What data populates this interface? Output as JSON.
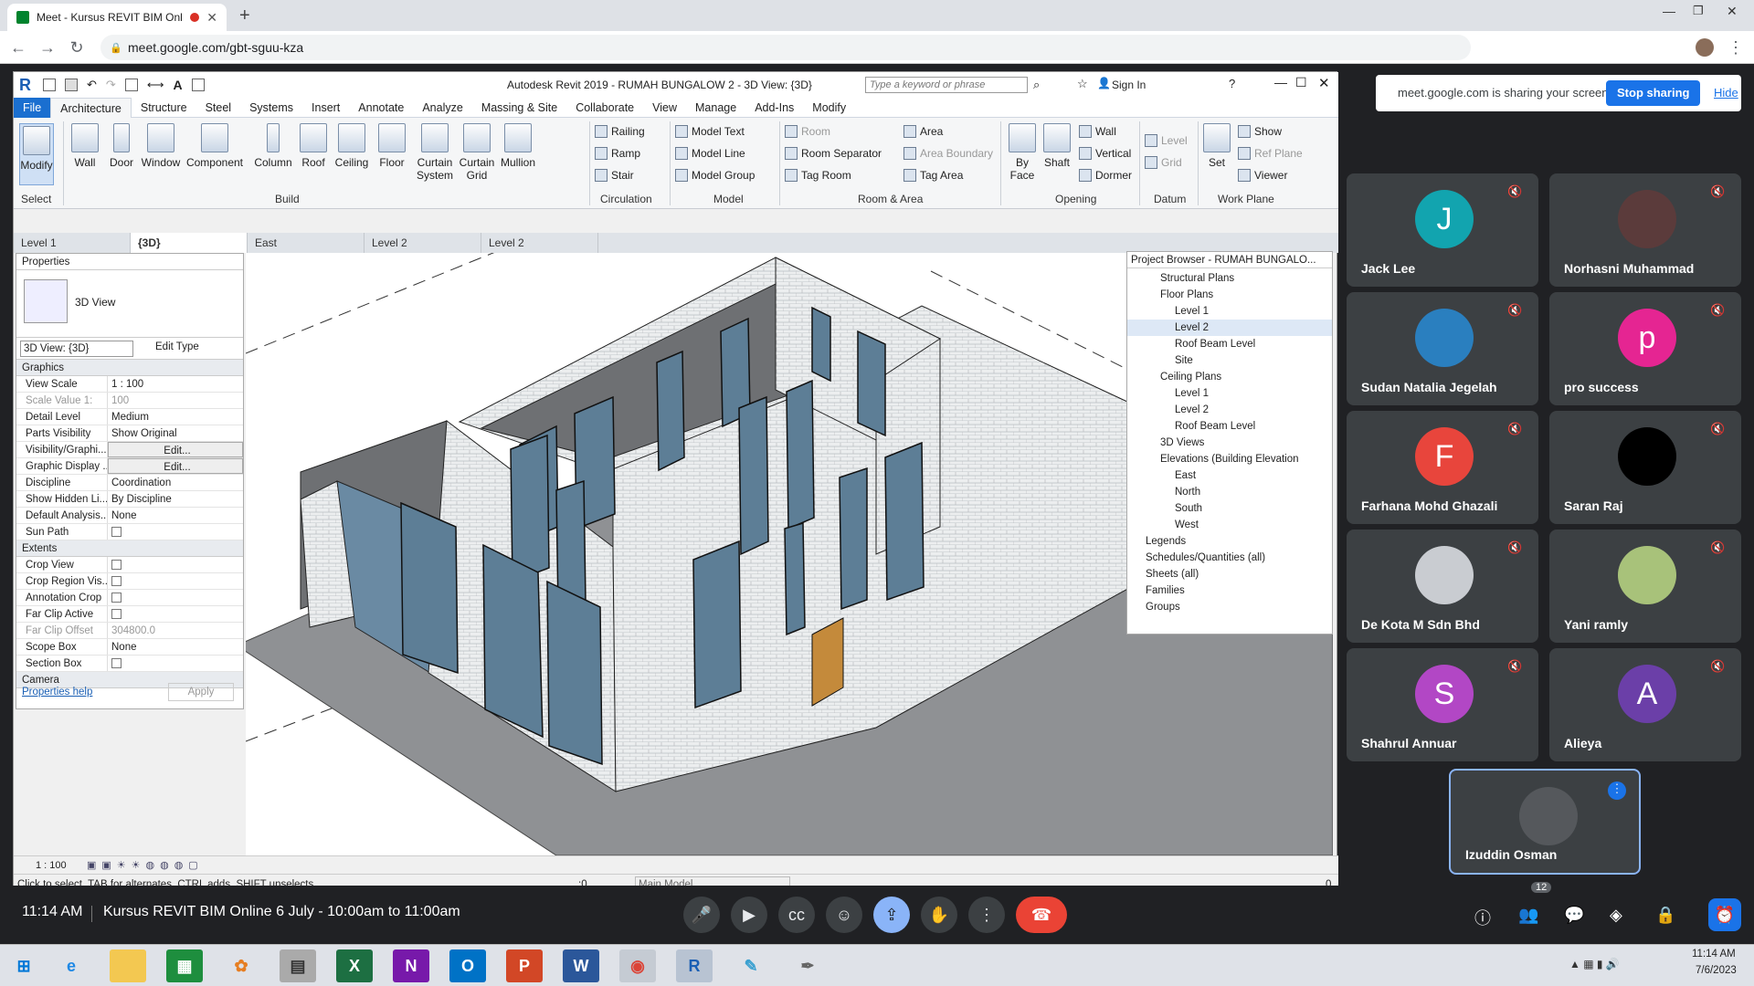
{
  "browser": {
    "tab_title": "Meet - Kursus REVIT BIM Onl",
    "url": "meet.google.com/gbt-sguu-kza"
  },
  "revit": {
    "title": "Autodesk Revit 2019 - RUMAH BUNGALOW 2 - 3D View: {3D}",
    "search_placeholder": "Type a keyword or phrase",
    "sign_in": "Sign In",
    "tabs": [
      "File",
      "Architecture",
      "Structure",
      "Steel",
      "Systems",
      "Insert",
      "Annotate",
      "Analyze",
      "Massing & Site",
      "Collaborate",
      "View",
      "Manage",
      "Add-Ins",
      "Modify"
    ],
    "ribbon": {
      "select": "Select",
      "modify": "Modify",
      "build": [
        "Wall",
        "Door",
        "Window",
        "Component",
        "Column",
        "Roof",
        "Ceiling",
        "Floor",
        "Curtain System",
        "Curtain Grid",
        "Mullion"
      ],
      "build_label": "Build",
      "circulation": [
        "Railing",
        "Ramp",
        "Stair"
      ],
      "circulation_label": "Circulation",
      "model": [
        "Model Text",
        "Model Line",
        "Model Group"
      ],
      "model_label": "Model",
      "room": [
        "Room",
        "Room Separator",
        "Tag Room",
        "Area",
        "Area Boundary",
        "Tag Area"
      ],
      "room_label": "Room & Area",
      "opening": [
        "By Face",
        "Shaft",
        "Wall",
        "Vertical",
        "Dormer"
      ],
      "opening_label": "Opening",
      "datum": [
        "Level",
        "Grid"
      ],
      "datum_label": "Datum",
      "workplane": [
        "Set",
        "Show",
        "Ref Plane",
        "Viewer"
      ],
      "workplane_label": "Work Plane"
    },
    "view_tabs": [
      "Level 1",
      "{3D}",
      "East",
      "Level 2",
      "Level 2"
    ],
    "properties": {
      "title": "Properties",
      "type": "3D View",
      "selector": "3D View: {3D}",
      "edit_type": "Edit Type",
      "graphics": "Graphics",
      "rows": [
        [
          "View Scale",
          "1 : 100"
        ],
        [
          "Scale Value  1:",
          "100"
        ],
        [
          "Detail Level",
          "Medium"
        ],
        [
          "Parts Visibility",
          "Show Original"
        ],
        [
          "Visibility/Graphi...",
          "Edit..."
        ],
        [
          "Graphic Display ...",
          "Edit..."
        ],
        [
          "Discipline",
          "Coordination"
        ],
        [
          "Show Hidden Li...",
          "By Discipline"
        ],
        [
          "Default Analysis...",
          "None"
        ],
        [
          "Sun Path",
          ""
        ]
      ],
      "extents": "Extents",
      "rows2": [
        [
          "Crop View",
          ""
        ],
        [
          "Crop Region Vis...",
          ""
        ],
        [
          "Annotation Crop",
          ""
        ],
        [
          "Far Clip Active",
          ""
        ],
        [
          "Far Clip Offset",
          "304800.0"
        ],
        [
          "Scope Box",
          "None"
        ],
        [
          "Section Box",
          ""
        ]
      ],
      "camera": "Camera",
      "help": "Properties help",
      "apply": "Apply"
    },
    "project_browser": {
      "title": "Project Browser - RUMAH BUNGALO...",
      "items": [
        "Structural Plans",
        "Floor Plans",
        "Level 1",
        "Level 2",
        "Roof Beam Level",
        "Site",
        "Ceiling Plans",
        "Level 1",
        "Level 2",
        "Roof Beam Level",
        "3D Views",
        "Elevations (Building Elevation",
        "East",
        "North",
        "South",
        "West",
        "Legends",
        "Schedules/Quantities (all)",
        "Sheets (all)",
        "Families",
        "Groups"
      ]
    },
    "view_scale": "1 : 100",
    "status": "Click to select, TAB for alternates, CTRL adds, SHIFT unselects.",
    "status_zero": ":0",
    "main_model": "Main Model",
    "filter_count": "0"
  },
  "meet": {
    "share_text": "meet.google.com is sharing your screen.",
    "stop_sharing": "Stop sharing",
    "hide": "Hide",
    "participants": [
      {
        "name": "Jack Lee",
        "initial": "J",
        "color": "#12a4af"
      },
      {
        "name": "Norhasni Muhammad",
        "initial": "",
        "color": "#5b3b3b"
      },
      {
        "name": "Sudan Natalia Jegelah",
        "initial": "",
        "color": "#2a7fbf"
      },
      {
        "name": "pro success",
        "initial": "p",
        "color": "#e52592"
      },
      {
        "name": "Farhana Mohd Ghazali",
        "initial": "F",
        "color": "#e8453c"
      },
      {
        "name": "Saran Raj",
        "initial": "",
        "color": "#000000"
      },
      {
        "name": "De Kota M Sdn Bhd",
        "initial": "",
        "color": "#c9ccd1"
      },
      {
        "name": "Yani ramly",
        "initial": "",
        "color": "#a8c27a"
      },
      {
        "name": "Shahrul Annuar",
        "initial": "S",
        "color": "#b247c5"
      },
      {
        "name": "Alieya",
        "initial": "A",
        "color": "#6b3fa8"
      },
      {
        "name": "Izuddin Osman",
        "initial": "",
        "color": "#55585c"
      }
    ],
    "time": "11:14 AM",
    "meeting_title": "Kursus REVIT BIM Online 6 July - 10:00am to 11:00am",
    "people_count": "12"
  },
  "taskbar": {
    "time": "11:14 AM",
    "date": "7/6/2023"
  }
}
